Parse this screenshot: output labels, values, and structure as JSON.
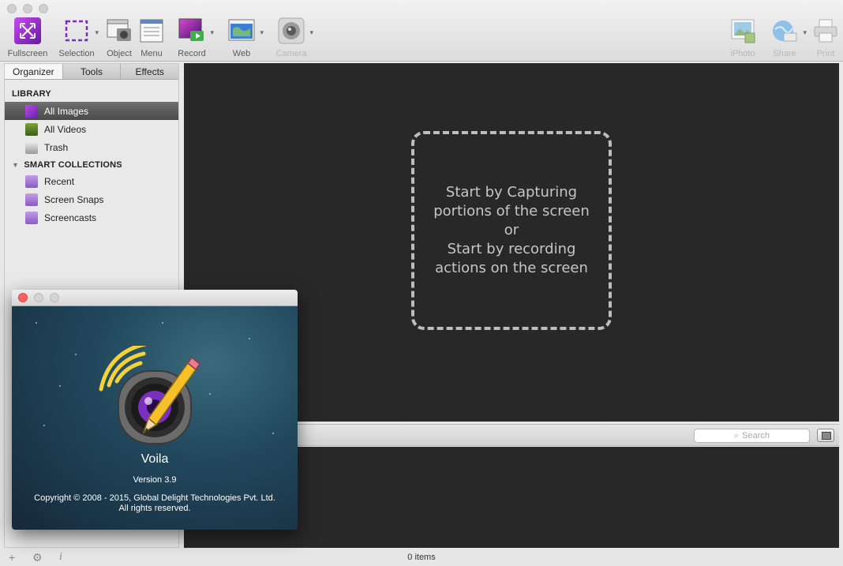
{
  "toolbar": {
    "items": [
      {
        "label": "Fullscreen",
        "icon": "fullscreen-icon",
        "enabled": true
      },
      {
        "label": "Selection",
        "icon": "selection-icon",
        "enabled": true
      },
      {
        "label": "Object",
        "icon": "object-icon",
        "enabled": true
      },
      {
        "label": "Menu",
        "icon": "menu-icon",
        "enabled": true
      },
      {
        "label": "Record",
        "icon": "record-icon",
        "enabled": true
      },
      {
        "label": "Web",
        "icon": "web-icon",
        "enabled": true
      },
      {
        "label": "Camera",
        "icon": "camera-icon",
        "enabled": false
      },
      {
        "label": "iPhoto",
        "icon": "iphoto-icon",
        "enabled": false
      },
      {
        "label": "Share",
        "icon": "share-icon",
        "enabled": false
      },
      {
        "label": "Print",
        "icon": "print-icon",
        "enabled": false
      }
    ]
  },
  "sidebar": {
    "tabs": [
      "Organizer",
      "Tools",
      "Effects"
    ],
    "active_tab": "Organizer",
    "library_heading": "LIBRARY",
    "library_items": [
      {
        "label": "All Images",
        "icon": "images-icon",
        "selected": true
      },
      {
        "label": "All Videos",
        "icon": "film-icon",
        "selected": false
      },
      {
        "label": "Trash",
        "icon": "trash-icon",
        "selected": false
      }
    ],
    "collections_heading": "SMART COLLECTIONS",
    "collection_items": [
      {
        "label": "Recent",
        "icon": "smart-folder-icon"
      },
      {
        "label": "Screen Snaps",
        "icon": "smart-folder-icon"
      },
      {
        "label": "Screencasts",
        "icon": "smart-folder-icon"
      }
    ]
  },
  "canvas": {
    "placeholder_lines": [
      "Start by Capturing",
      "portions of the screen",
      "or",
      "Start by recording",
      "actions on the screen"
    ]
  },
  "search": {
    "placeholder": "Search"
  },
  "status": {
    "count": "0 items"
  },
  "about": {
    "app_name": "Voila",
    "version": "Version 3.9",
    "copyright": "Copyright © 2008 - 2015, Global Delight Technologies Pvt. Ltd.",
    "rights": "All rights reserved."
  },
  "colors": {
    "canvas_bg": "#282828",
    "accent_purple": "#7b2fc0",
    "close_red": "#fc605c"
  }
}
